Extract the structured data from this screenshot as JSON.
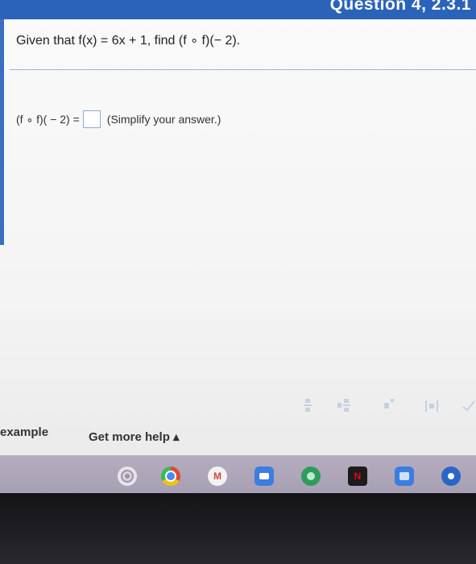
{
  "header": {
    "question_label": "Question 4, 2.3.1"
  },
  "question": {
    "text": "Given that f(x) = 6x + 1, find (f ∘ f)(− 2)."
  },
  "answer": {
    "prefix": "(f ∘ f)( − 2) =",
    "hint": "(Simplify your answer.)"
  },
  "footer": {
    "example_label": "example",
    "help_label": "Get more help ▴"
  },
  "toolbar": {
    "icons": [
      "fraction-icon",
      "mixed-number-icon",
      "exponent-icon",
      "absolute-value-icon",
      "check-icon"
    ]
  },
  "shelf": {
    "apps": [
      "settings",
      "chrome",
      "gmail",
      "docs",
      "play",
      "netflix",
      "files",
      "store"
    ]
  },
  "colors": {
    "accent": "#2b63b8",
    "shelf": "#b1a9bd"
  }
}
